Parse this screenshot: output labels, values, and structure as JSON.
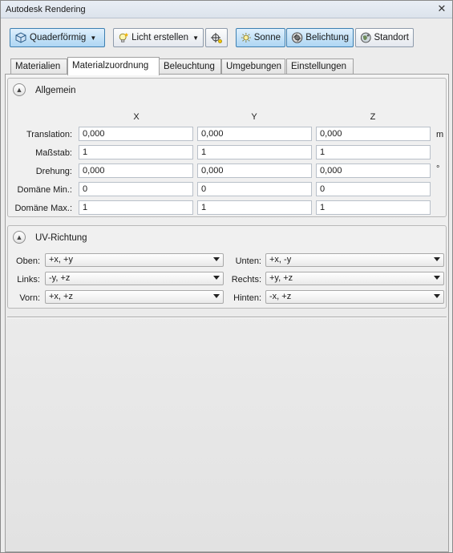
{
  "window": {
    "title": "Autodesk Rendering",
    "close_glyph": "✕"
  },
  "toolbar": {
    "mapping_button": {
      "label": "Quaderförmig",
      "icon": "box-icon"
    },
    "light_button": {
      "label": "Licht erstellen",
      "icon": "light-bulb-icon"
    },
    "target_button": {
      "icon": "target-light-icon"
    },
    "sun_button": {
      "label": "Sonne",
      "icon": "sun-icon"
    },
    "exposure_button": {
      "label": "Belichtung",
      "icon": "exposure-icon"
    },
    "location_button": {
      "label": "Standort",
      "icon": "globe-icon"
    }
  },
  "tabs": [
    {
      "label": "Materialien"
    },
    {
      "label": "Materialzuordnung"
    },
    {
      "label": "Beleuchtung"
    },
    {
      "label": "Umgebungen"
    },
    {
      "label": "Einstellungen"
    }
  ],
  "selected_tab": "Materialzuordnung",
  "general": {
    "title": "Allgemein",
    "columns": [
      "X",
      "Y",
      "Z"
    ],
    "rows": [
      {
        "label": "Translation:",
        "values": [
          "0,000",
          "0,000",
          "0,000"
        ],
        "unit": "m"
      },
      {
        "label": "Maßstab:",
        "values": [
          "1",
          "1",
          "1"
        ],
        "unit": ""
      },
      {
        "label": "Drehung:",
        "values": [
          "0,000",
          "0,000",
          "0,000"
        ],
        "unit": "°"
      },
      {
        "label": "Domäne Min.:",
        "values": [
          "0",
          "0",
          "0"
        ],
        "unit": ""
      },
      {
        "label": "Domäne Max.:",
        "values": [
          "1",
          "1",
          "1"
        ],
        "unit": ""
      }
    ]
  },
  "uv": {
    "title": "UV-Richtung",
    "left": [
      {
        "label": "Oben:",
        "value": "+x, +y"
      },
      {
        "label": "Links:",
        "value": "-y, +z"
      },
      {
        "label": "Vorn:",
        "value": "+x, +z"
      }
    ],
    "right": [
      {
        "label": "Unten:",
        "value": "+x, -y"
      },
      {
        "label": "Rechts:",
        "value": "+y, +z"
      },
      {
        "label": "Hinten:",
        "value": "-x, +z"
      }
    ]
  },
  "colors": {
    "accent": "#aed6f3",
    "accent_border": "#3c7fb1"
  }
}
